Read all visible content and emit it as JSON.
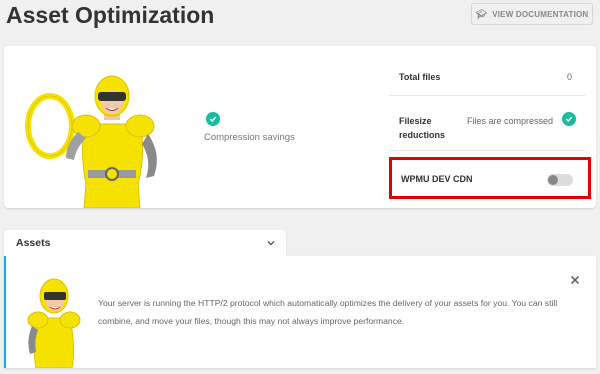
{
  "header": {
    "title": "Asset Optimization",
    "doc_button": "VIEW DOCUMENTATION",
    "doc_icon": "graduation-cap-icon"
  },
  "summary": {
    "compression_label": "Compression savings",
    "total_files_label": "Total files",
    "total_files_value": "0",
    "filesize_label_1": "Filesize",
    "filesize_label_2": "reductions",
    "filesize_value": "Files are compressed",
    "cdn_label": "WPMU DEV CDN",
    "cdn_enabled": false,
    "status_color": "#1abc9c",
    "highlight_color": "#e00000"
  },
  "assets": {
    "label": "Assets",
    "notice_text": "Your server is running the HTTP/2 protocol which automatically optimizes the delivery of your assets for you. You can still combine, and move your files, though this may not always improve performance.",
    "notice_accent": "#17a8e3"
  }
}
